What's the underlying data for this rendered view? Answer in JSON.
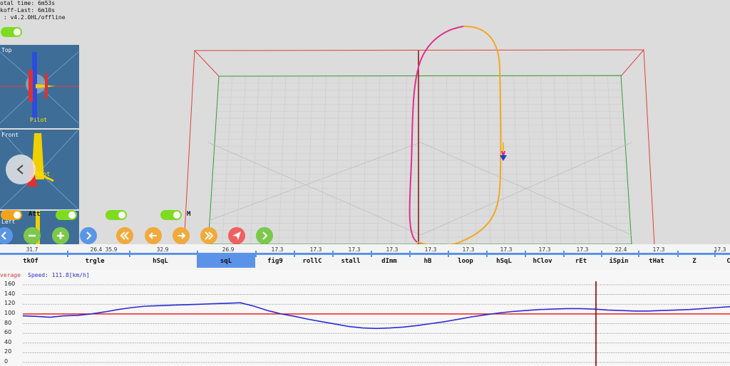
{
  "info": {
    "total_time": "otal time: 6m53s",
    "takeoff_last": "koff-Last: 6m10s",
    "version": " : v4.2.0HL/offline"
  },
  "views": {
    "top": {
      "label": "Top",
      "pilot": "Pilot"
    },
    "front": {
      "label": "Front",
      "pilot": "Pilot"
    },
    "left": {
      "label": "Left"
    }
  },
  "toggles": {
    "att_label": "Att",
    "m_label": "M"
  },
  "timeline": {
    "durations": [
      "31.7",
      "26.4",
      "35.9",
      "32.9",
      "26.9",
      "17.3",
      "17.3",
      "17.3",
      "17.3",
      "17.3",
      "17.3",
      "17.3",
      "17.3",
      "17.3",
      "22.4",
      "17.3",
      "17.3"
    ],
    "maneuvers": [
      "tkOf",
      "trgle",
      "hSqL",
      "sqL",
      "fig9",
      "rollC",
      "stall",
      "dImm",
      "hB",
      "loop",
      "hSqL",
      "hClov",
      "rEt",
      "iSpin",
      "tHat",
      "Z",
      "C"
    ],
    "selected": "sqL"
  },
  "speed_chart": {
    "caption_prefix": "verage",
    "caption_speed": "Speed: 111.8[km/h]",
    "y_ticks": [
      "160",
      "140",
      "120",
      "100",
      "80",
      "60",
      "40",
      "20",
      "0"
    ]
  },
  "chart_data": {
    "type": "line",
    "title": "",
    "xlabel": "",
    "ylabel": "",
    "ylim": [
      0,
      160
    ],
    "average": 100,
    "series": [
      {
        "values": [
          96,
          95,
          93,
          96,
          97,
          100,
          104,
          109,
          113,
          116,
          117,
          118,
          119,
          120,
          121,
          122,
          123,
          116,
          107,
          100,
          95,
          89,
          84,
          79,
          74,
          71,
          70,
          71,
          73,
          76,
          80,
          84,
          89,
          94,
          98,
          102,
          105,
          107,
          109,
          110,
          111,
          111,
          110,
          108,
          107,
          106,
          106,
          107,
          108,
          109,
          111,
          113,
          115
        ]
      }
    ],
    "colors": {
      "series": "#2b2bd6",
      "average": "#ee2222",
      "cursor": "#8b0000"
    }
  }
}
